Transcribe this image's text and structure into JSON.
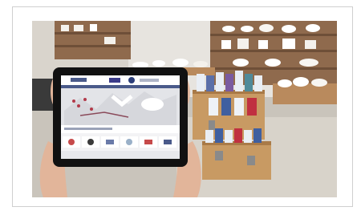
{
  "photo": {
    "subject": "hands-holding-tablet-in-tableware-store",
    "colors": {
      "wall": "#e7e4df",
      "floor": "#c9c4bb",
      "shelf_wood": "#a8764a",
      "crate_wood": "#c89a63",
      "tablet_frame": "#111111",
      "skin": "#e2b59a"
    }
  }
}
